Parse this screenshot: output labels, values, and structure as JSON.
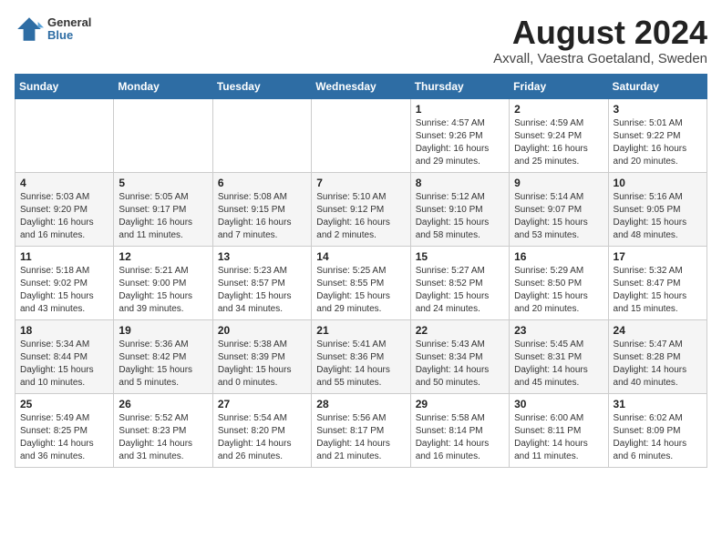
{
  "logo": {
    "general": "General",
    "blue": "Blue"
  },
  "title": "August 2024",
  "location": "Axvall, Vaestra Goetaland, Sweden",
  "days_header": [
    "Sunday",
    "Monday",
    "Tuesday",
    "Wednesday",
    "Thursday",
    "Friday",
    "Saturday"
  ],
  "weeks": [
    [
      {
        "day": "",
        "text": ""
      },
      {
        "day": "",
        "text": ""
      },
      {
        "day": "",
        "text": ""
      },
      {
        "day": "",
        "text": ""
      },
      {
        "day": "1",
        "text": "Sunrise: 4:57 AM\nSunset: 9:26 PM\nDaylight: 16 hours\nand 29 minutes."
      },
      {
        "day": "2",
        "text": "Sunrise: 4:59 AM\nSunset: 9:24 PM\nDaylight: 16 hours\nand 25 minutes."
      },
      {
        "day": "3",
        "text": "Sunrise: 5:01 AM\nSunset: 9:22 PM\nDaylight: 16 hours\nand 20 minutes."
      }
    ],
    [
      {
        "day": "4",
        "text": "Sunrise: 5:03 AM\nSunset: 9:20 PM\nDaylight: 16 hours\nand 16 minutes."
      },
      {
        "day": "5",
        "text": "Sunrise: 5:05 AM\nSunset: 9:17 PM\nDaylight: 16 hours\nand 11 minutes."
      },
      {
        "day": "6",
        "text": "Sunrise: 5:08 AM\nSunset: 9:15 PM\nDaylight: 16 hours\nand 7 minutes."
      },
      {
        "day": "7",
        "text": "Sunrise: 5:10 AM\nSunset: 9:12 PM\nDaylight: 16 hours\nand 2 minutes."
      },
      {
        "day": "8",
        "text": "Sunrise: 5:12 AM\nSunset: 9:10 PM\nDaylight: 15 hours\nand 58 minutes."
      },
      {
        "day": "9",
        "text": "Sunrise: 5:14 AM\nSunset: 9:07 PM\nDaylight: 15 hours\nand 53 minutes."
      },
      {
        "day": "10",
        "text": "Sunrise: 5:16 AM\nSunset: 9:05 PM\nDaylight: 15 hours\nand 48 minutes."
      }
    ],
    [
      {
        "day": "11",
        "text": "Sunrise: 5:18 AM\nSunset: 9:02 PM\nDaylight: 15 hours\nand 43 minutes."
      },
      {
        "day": "12",
        "text": "Sunrise: 5:21 AM\nSunset: 9:00 PM\nDaylight: 15 hours\nand 39 minutes."
      },
      {
        "day": "13",
        "text": "Sunrise: 5:23 AM\nSunset: 8:57 PM\nDaylight: 15 hours\nand 34 minutes."
      },
      {
        "day": "14",
        "text": "Sunrise: 5:25 AM\nSunset: 8:55 PM\nDaylight: 15 hours\nand 29 minutes."
      },
      {
        "day": "15",
        "text": "Sunrise: 5:27 AM\nSunset: 8:52 PM\nDaylight: 15 hours\nand 24 minutes."
      },
      {
        "day": "16",
        "text": "Sunrise: 5:29 AM\nSunset: 8:50 PM\nDaylight: 15 hours\nand 20 minutes."
      },
      {
        "day": "17",
        "text": "Sunrise: 5:32 AM\nSunset: 8:47 PM\nDaylight: 15 hours\nand 15 minutes."
      }
    ],
    [
      {
        "day": "18",
        "text": "Sunrise: 5:34 AM\nSunset: 8:44 PM\nDaylight: 15 hours\nand 10 minutes."
      },
      {
        "day": "19",
        "text": "Sunrise: 5:36 AM\nSunset: 8:42 PM\nDaylight: 15 hours\nand 5 minutes."
      },
      {
        "day": "20",
        "text": "Sunrise: 5:38 AM\nSunset: 8:39 PM\nDaylight: 15 hours\nand 0 minutes."
      },
      {
        "day": "21",
        "text": "Sunrise: 5:41 AM\nSunset: 8:36 PM\nDaylight: 14 hours\nand 55 minutes."
      },
      {
        "day": "22",
        "text": "Sunrise: 5:43 AM\nSunset: 8:34 PM\nDaylight: 14 hours\nand 50 minutes."
      },
      {
        "day": "23",
        "text": "Sunrise: 5:45 AM\nSunset: 8:31 PM\nDaylight: 14 hours\nand 45 minutes."
      },
      {
        "day": "24",
        "text": "Sunrise: 5:47 AM\nSunset: 8:28 PM\nDaylight: 14 hours\nand 40 minutes."
      }
    ],
    [
      {
        "day": "25",
        "text": "Sunrise: 5:49 AM\nSunset: 8:25 PM\nDaylight: 14 hours\nand 36 minutes."
      },
      {
        "day": "26",
        "text": "Sunrise: 5:52 AM\nSunset: 8:23 PM\nDaylight: 14 hours\nand 31 minutes."
      },
      {
        "day": "27",
        "text": "Sunrise: 5:54 AM\nSunset: 8:20 PM\nDaylight: 14 hours\nand 26 minutes."
      },
      {
        "day": "28",
        "text": "Sunrise: 5:56 AM\nSunset: 8:17 PM\nDaylight: 14 hours\nand 21 minutes."
      },
      {
        "day": "29",
        "text": "Sunrise: 5:58 AM\nSunset: 8:14 PM\nDaylight: 14 hours\nand 16 minutes."
      },
      {
        "day": "30",
        "text": "Sunrise: 6:00 AM\nSunset: 8:11 PM\nDaylight: 14 hours\nand 11 minutes."
      },
      {
        "day": "31",
        "text": "Sunrise: 6:02 AM\nSunset: 8:09 PM\nDaylight: 14 hours\nand 6 minutes."
      }
    ]
  ]
}
